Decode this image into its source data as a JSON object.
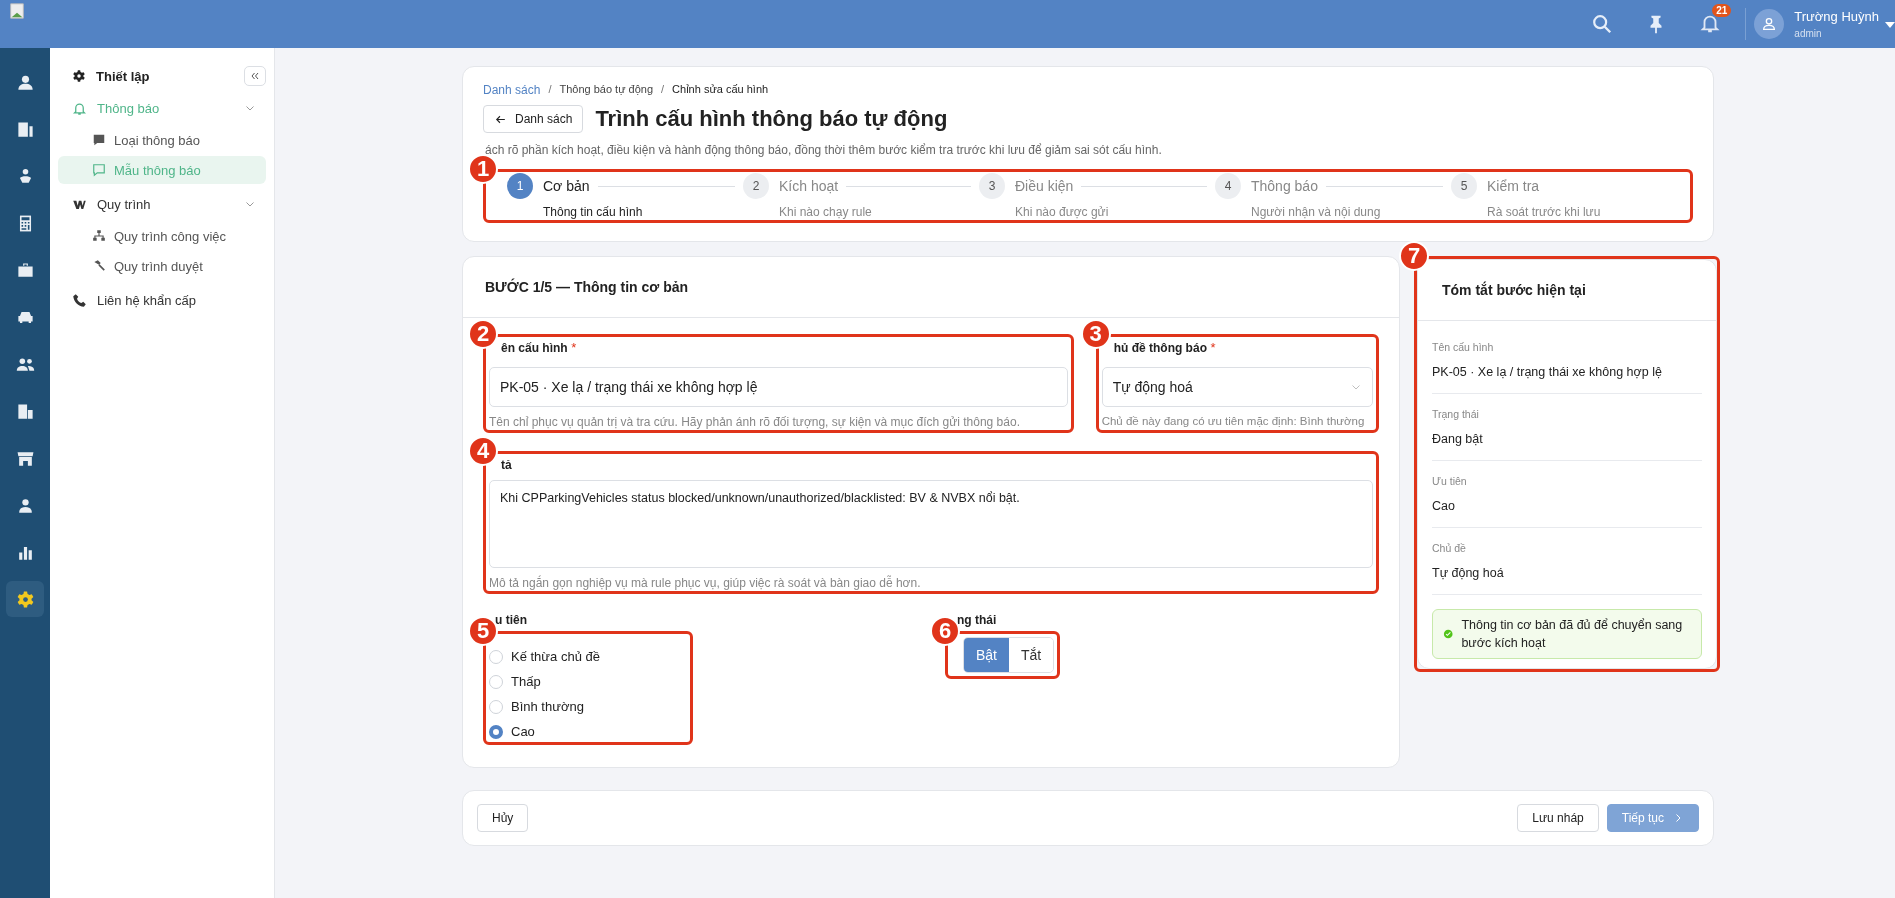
{
  "header": {
    "notification_count": "21",
    "user_name": "Trường Huỳnh",
    "user_role": "admin"
  },
  "rail": [
    {
      "selected": false
    },
    {
      "selected": false
    },
    {
      "selected": false
    },
    {
      "selected": false
    },
    {
      "selected": false
    },
    {
      "selected": false
    },
    {
      "selected": false
    },
    {
      "selected": false
    },
    {
      "selected": false
    },
    {
      "selected": false
    },
    {
      "selected": false
    },
    {
      "selected": true
    }
  ],
  "sidebar": {
    "title": "Thiết lập",
    "groups": [
      {
        "label": "Thông báo",
        "selected": true,
        "expanded": true,
        "children": [
          {
            "label": "Loại thông báo",
            "selected": false
          },
          {
            "label": "Mẫu thông báo",
            "selected": true
          }
        ]
      },
      {
        "label": "Quy trình",
        "selected": false,
        "expanded": true,
        "children": [
          {
            "label": "Quy trình công việc",
            "selected": false
          },
          {
            "label": "Quy trình duyệt",
            "selected": false
          }
        ]
      },
      {
        "label": "Liên hệ khẩn cấp",
        "selected": false
      }
    ]
  },
  "breadcrumb": [
    "Danh sách",
    "Thông báo tự động",
    "Chỉnh sửa cấu hình"
  ],
  "breadcrumb_separator": "/",
  "back_button": "Danh sách",
  "title": "Trình cấu hình thông báo tự động",
  "description": "ách rõ phần kích hoạt, điều kiện và hành động thông báo, đồng thời thêm bước kiểm tra trước khi lưu để giảm sai sót cấu hình.",
  "steps_annotation": "1",
  "steps": [
    {
      "number": "1",
      "title": "Cơ bản",
      "subtitle": "Thông tin cấu hình",
      "selected": true
    },
    {
      "number": "2",
      "title": "Kích hoạt",
      "subtitle": "Khi nào chạy rule",
      "selected": false
    },
    {
      "number": "3",
      "title": "Điều kiện",
      "subtitle": "Khi nào được gửi",
      "selected": false
    },
    {
      "number": "4",
      "title": "Thông báo",
      "subtitle": "Người nhận và nội dung",
      "selected": false
    },
    {
      "number": "5",
      "title": "Kiểm tra",
      "subtitle": "Rà soát trước khi lưu",
      "selected": false
    }
  ],
  "form": {
    "heading": "BƯỚC 1/5 — Thông tin cơ bản",
    "name_field": {
      "annotation": "2",
      "label": "ên cấu hình",
      "required_mark": "*",
      "value": "PK-05 · Xe lạ / trạng thái xe không hợp lệ",
      "hint": "Tên chỉ phục vụ quản trị và tra cứu. Hãy phản ánh rõ đối tượng, sự kiện và mục đích gửi thông báo."
    },
    "topic_field": {
      "annotation": "3",
      "label": "hủ đề thông báo",
      "required_mark": "*",
      "value": "Tự động hoá",
      "hint": "Chủ đề này đang có ưu tiên mặc định: Bình thường"
    },
    "description_field": {
      "annotation": "4",
      "label": "tả",
      "value": "Khi CPParkingVehicles status blocked/unknown/unauthorized/blacklisted: BV & NVBX nổi bật.",
      "hint": "Mô tả ngắn gọn nghiệp vụ mà rule phục vụ, giúp việc rà soát và bàn giao dễ hơn."
    },
    "priority": {
      "annotation": "5",
      "label": "u tiên",
      "options": [
        {
          "label": "Kế thừa chủ đề",
          "selected": false
        },
        {
          "label": "Thấp",
          "selected": false
        },
        {
          "label": "Bình thường",
          "selected": false
        },
        {
          "label": "Cao",
          "selected": true
        }
      ]
    },
    "status": {
      "annotation": "6",
      "label": "ng thái",
      "options": [
        {
          "label": "Bật",
          "selected": true
        },
        {
          "label": "Tắt",
          "selected": false
        }
      ]
    }
  },
  "summary": {
    "annotation": "7",
    "title": "Tóm tắt bước hiện tại",
    "items": [
      {
        "label": "Tên cấu hình",
        "value": "PK-05 · Xe lạ / trạng thái xe không hợp lệ"
      },
      {
        "label": "Trạng thái",
        "value": "Đang bật"
      },
      {
        "label": "Ưu tiên",
        "value": "Cao"
      },
      {
        "label": "Chủ đề",
        "value": "Tự động hoá"
      }
    ],
    "notice": "Thông tin cơ bản đã đủ để chuyển sang bước kích hoạt"
  },
  "footer": {
    "cancel": "Hủy",
    "save_draft": "Lưu nháp",
    "next": "Tiếp tục"
  }
}
